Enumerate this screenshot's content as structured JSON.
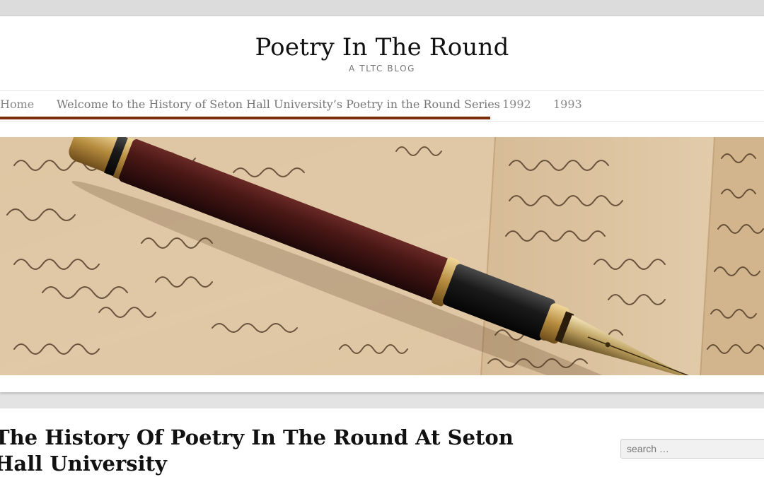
{
  "site": {
    "title": "Poetry In The Round",
    "description": "A TLTC BLOG"
  },
  "nav": {
    "items": [
      {
        "label": "Home"
      },
      {
        "label": "Welcome to the History of Seton Hall University’s Poetry in the Round Series",
        "active": true
      },
      {
        "label": "1992"
      },
      {
        "label": "1993"
      }
    ],
    "active_color": "#7a2e0c"
  },
  "hero": {
    "alt": "fountain-pen-on-handwritten-letters"
  },
  "post": {
    "title": "The History Of Poetry In The Round At Seton Hall University"
  },
  "search": {
    "placeholder": "search …"
  }
}
